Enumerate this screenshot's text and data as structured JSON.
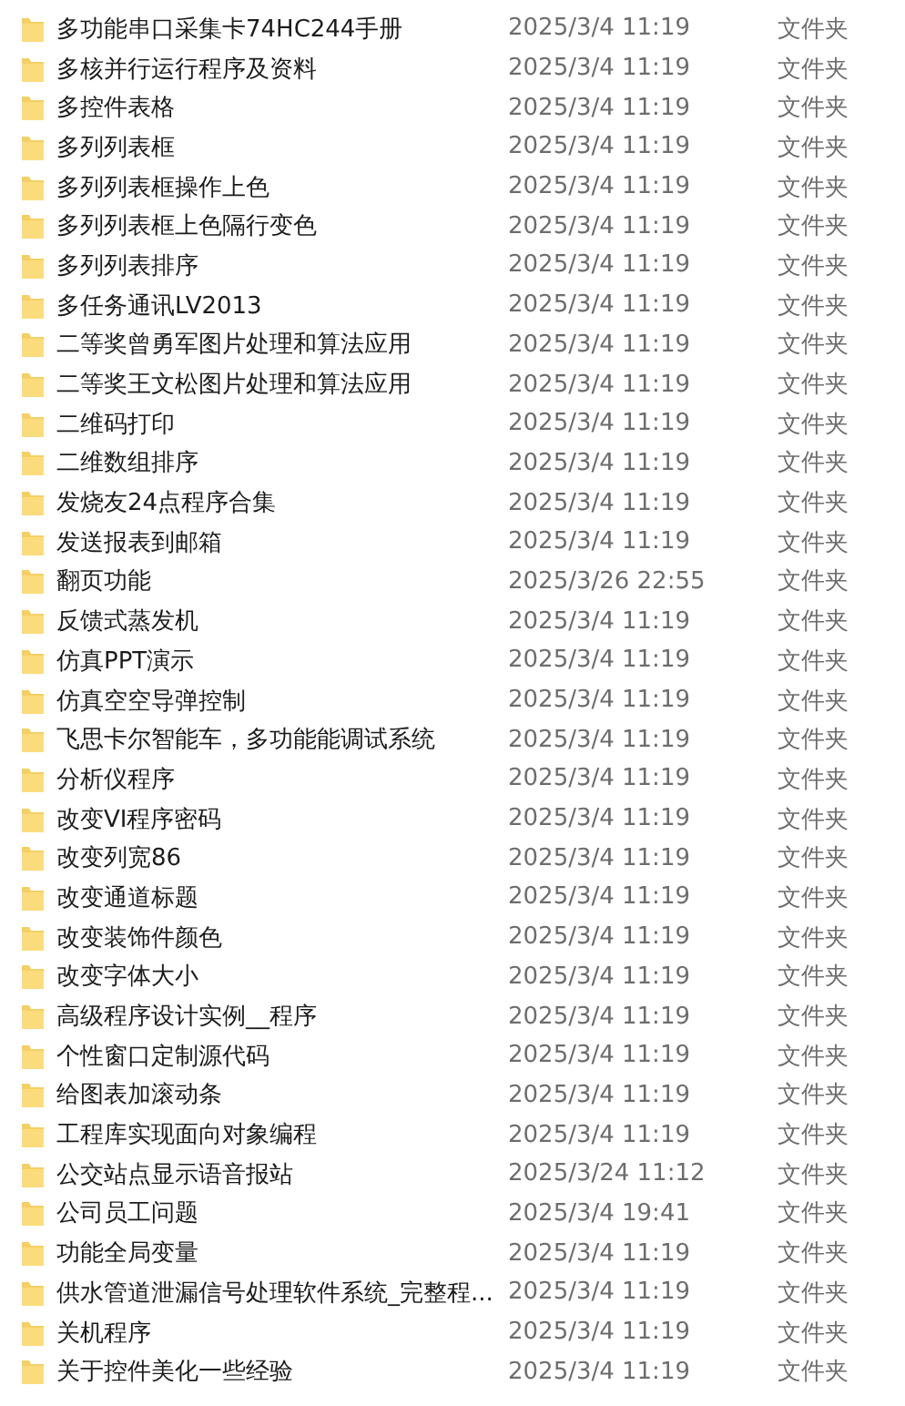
{
  "files": [
    {
      "name": "多功能串口采集卡74HC244手册",
      "date": "2025/3/4 11:19",
      "type": "文件夹"
    },
    {
      "name": "多核并行运行程序及资料",
      "date": "2025/3/4 11:19",
      "type": "文件夹"
    },
    {
      "name": "多控件表格",
      "date": "2025/3/4 11:19",
      "type": "文件夹"
    },
    {
      "name": "多列列表框",
      "date": "2025/3/4 11:19",
      "type": "文件夹"
    },
    {
      "name": "多列列表框操作上色",
      "date": "2025/3/4 11:19",
      "type": "文件夹"
    },
    {
      "name": "多列列表框上色隔行变色",
      "date": "2025/3/4 11:19",
      "type": "文件夹"
    },
    {
      "name": "多列列表排序",
      "date": "2025/3/4 11:19",
      "type": "文件夹"
    },
    {
      "name": "多任务通讯LV2013",
      "date": "2025/3/4 11:19",
      "type": "文件夹"
    },
    {
      "name": "二等奖曾勇军图片处理和算法应用",
      "date": "2025/3/4 11:19",
      "type": "文件夹"
    },
    {
      "name": "二等奖王文松图片处理和算法应用",
      "date": "2025/3/4 11:19",
      "type": "文件夹"
    },
    {
      "name": "二维码打印",
      "date": "2025/3/4 11:19",
      "type": "文件夹"
    },
    {
      "name": "二维数组排序",
      "date": "2025/3/4 11:19",
      "type": "文件夹"
    },
    {
      "name": "发烧友24点程序合集",
      "date": "2025/3/4 11:19",
      "type": "文件夹"
    },
    {
      "name": "发送报表到邮箱",
      "date": "2025/3/4 11:19",
      "type": "文件夹"
    },
    {
      "name": "翻页功能",
      "date": "2025/3/26 22:55",
      "type": "文件夹"
    },
    {
      "name": "反馈式蒸发机",
      "date": "2025/3/4 11:19",
      "type": "文件夹"
    },
    {
      "name": "仿真PPT演示",
      "date": "2025/3/4 11:19",
      "type": "文件夹"
    },
    {
      "name": "仿真空空导弹控制",
      "date": "2025/3/4 11:19",
      "type": "文件夹"
    },
    {
      "name": "飞思卡尔智能车，多功能能调试系统",
      "date": "2025/3/4 11:19",
      "type": "文件夹"
    },
    {
      "name": "分析仪程序",
      "date": "2025/3/4 11:19",
      "type": "文件夹"
    },
    {
      "name": "改变VI程序密码",
      "date": "2025/3/4 11:19",
      "type": "文件夹"
    },
    {
      "name": "改变列宽86",
      "date": "2025/3/4 11:19",
      "type": "文件夹"
    },
    {
      "name": "改变通道标题",
      "date": "2025/3/4 11:19",
      "type": "文件夹"
    },
    {
      "name": "改变装饰件颜色",
      "date": "2025/3/4 11:19",
      "type": "文件夹"
    },
    {
      "name": "改变字体大小",
      "date": "2025/3/4 11:19",
      "type": "文件夹"
    },
    {
      "name": "高级程序设计实例__程序",
      "date": "2025/3/4 11:19",
      "type": "文件夹"
    },
    {
      "name": "个性窗口定制源代码",
      "date": "2025/3/4 11:19",
      "type": "文件夹"
    },
    {
      "name": "给图表加滚动条",
      "date": "2025/3/4 11:19",
      "type": "文件夹"
    },
    {
      "name": "工程库实现面向对象编程",
      "date": "2025/3/4 11:19",
      "type": "文件夹"
    },
    {
      "name": "公交站点显示语音报站",
      "date": "2025/3/24 11:12",
      "type": "文件夹"
    },
    {
      "name": "公司员工问题",
      "date": "2025/3/4 19:41",
      "type": "文件夹"
    },
    {
      "name": "功能全局变量",
      "date": "2025/3/4 11:19",
      "type": "文件夹"
    },
    {
      "name": "供水管道泄漏信号处理软件系统_完整程...",
      "date": "2025/3/4 11:19",
      "type": "文件夹"
    },
    {
      "name": "关机程序",
      "date": "2025/3/4 11:19",
      "type": "文件夹"
    },
    {
      "name": "关于控件美化一些经验",
      "date": "2025/3/4 11:19",
      "type": "文件夹"
    }
  ]
}
